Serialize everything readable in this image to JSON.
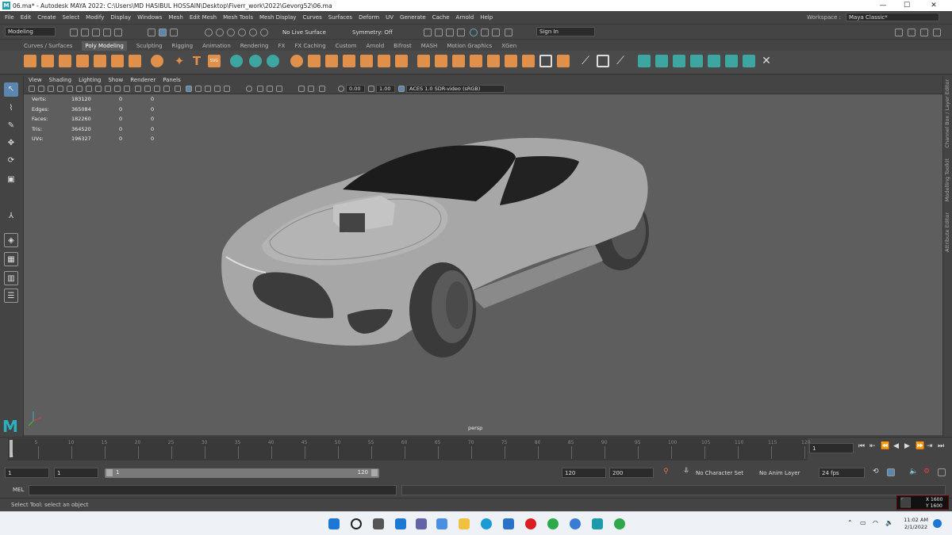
{
  "window": {
    "title": "06.ma* - Autodesk MAYA 2022: C:\\Users\\MD HASIBUL HOSSAIN\\Desktop\\Fiverr_work\\2022\\Gevorg52\\06.ma"
  },
  "menubar": {
    "items": [
      "File",
      "Edit",
      "Create",
      "Select",
      "Modify",
      "Display",
      "Windows",
      "Mesh",
      "Edit Mesh",
      "Mesh Tools",
      "Mesh Display",
      "Curves",
      "Surfaces",
      "Deform",
      "UV",
      "Generate",
      "Cache",
      "Arnold",
      "Help"
    ]
  },
  "workspace": {
    "label": "Workspace :",
    "value": "Maya Classic*"
  },
  "statusline": {
    "mode": "Modeling",
    "live_surface": "No Live Surface",
    "symmetry": "Symmetry: Off",
    "signin": "Sign In"
  },
  "shelf": {
    "tabs": [
      "Curves / Surfaces",
      "Poly Modeling",
      "Sculpting",
      "Rigging",
      "Animation",
      "Rendering",
      "FX",
      "FX Caching",
      "Custom",
      "Arnold",
      "Bifrost",
      "MASH",
      "Motion Graphics",
      "XGen"
    ],
    "active": "Poly Modeling"
  },
  "viewport": {
    "menu": [
      "View",
      "Shading",
      "Lighting",
      "Show",
      "Renderer",
      "Panels"
    ],
    "exposure": "0.00",
    "gamma": "1.00",
    "colorspace": "ACES 1.0 SDR-video (sRGB)",
    "camera": "persp",
    "hud": [
      {
        "label": "Verts:",
        "v1": "183120",
        "v2": "0",
        "v3": "0"
      },
      {
        "label": "Edges:",
        "v1": "365084",
        "v2": "0",
        "v3": "0"
      },
      {
        "label": "Faces:",
        "v1": "182260",
        "v2": "0",
        "v3": "0"
      },
      {
        "label": "Tris:",
        "v1": "364520",
        "v2": "0",
        "v3": "0"
      },
      {
        "label": "UVs:",
        "v1": "196327",
        "v2": "0",
        "v3": "0"
      }
    ]
  },
  "right_tabs": [
    "Channel Box / Layer Editor",
    "Modelling Toolkit",
    "Attribute Editor"
  ],
  "timeline": {
    "ticks": [
      "5",
      "10",
      "15",
      "20",
      "25",
      "30",
      "35",
      "40",
      "45",
      "50",
      "55",
      "60",
      "65",
      "70",
      "75",
      "80",
      "85",
      "90",
      "95",
      "100",
      "105",
      "110",
      "115",
      "120"
    ],
    "current_frame": "1",
    "current_field": "1"
  },
  "range": {
    "start": "1",
    "start2": "1",
    "slider_start": "1",
    "slider_end": "120",
    "end": "120",
    "end2": "200",
    "character_set": "No Character Set",
    "anim_layer": "No Anim Layer",
    "fps": "24 fps"
  },
  "mel": {
    "label": "MEL"
  },
  "helpline": {
    "text": "Select Tool: select an object"
  },
  "gpu": {
    "x": "X 1600",
    "y": "Y 1600"
  },
  "taskbar": {
    "time": "11:02 AM",
    "date": "2/1/2022"
  }
}
